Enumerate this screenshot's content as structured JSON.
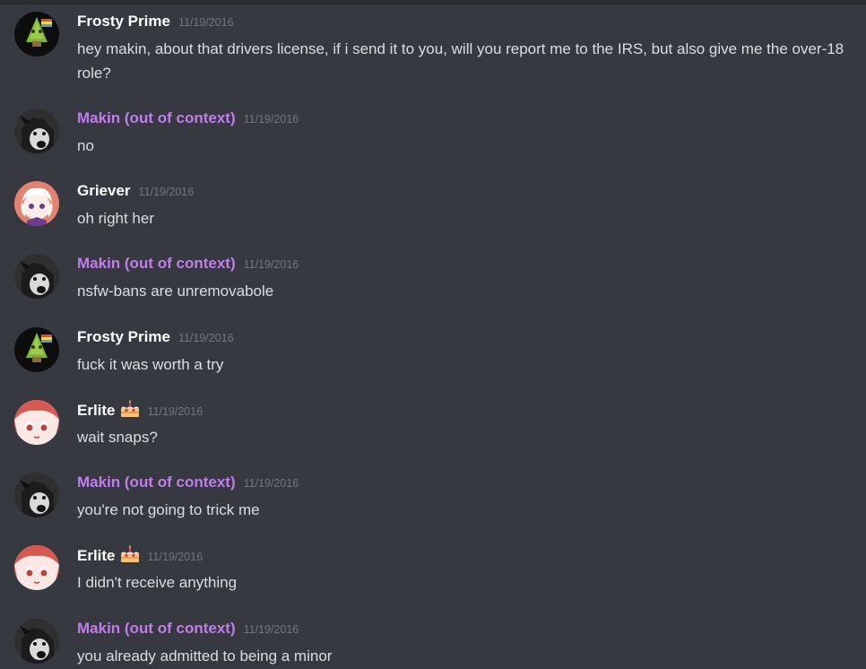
{
  "messages": [
    {
      "author": "Frosty Prime",
      "timestamp": "11/19/2016",
      "text": "hey makin, about that drivers license, if i send it to you, will you report me to the IRS, but also give me the over-18 role?"
    },
    {
      "author": "Makin (out of context)",
      "timestamp": "11/19/2016",
      "text": "no"
    },
    {
      "author": "Griever",
      "timestamp": "11/19/2016",
      "text": "oh right her"
    },
    {
      "author": "Makin (out of context)",
      "timestamp": "11/19/2016",
      "text": "nsfw-bans are unremovabole"
    },
    {
      "author": "Frosty Prime",
      "timestamp": "11/19/2016",
      "text": "fuck it was worth a try"
    },
    {
      "author": "Erlite",
      "timestamp": "11/19/2016",
      "text": "wait snaps?",
      "badge": "cake-emoji-icon"
    },
    {
      "author": "Makin (out of context)",
      "timestamp": "11/19/2016",
      "text": "you're not going to trick me"
    },
    {
      "author": "Erlite",
      "timestamp": "11/19/2016",
      "text": "I didn't receive anything",
      "badge": "cake-emoji-icon"
    },
    {
      "author": "Makin (out of context)",
      "timestamp": "11/19/2016",
      "text": "you already admitted to being a minor"
    }
  ],
  "colors": {
    "background": "#36393f",
    "username_default": "#ffffff",
    "username_role": "#c27cee",
    "timestamp": "#72767d",
    "message_text": "#dcddde"
  }
}
